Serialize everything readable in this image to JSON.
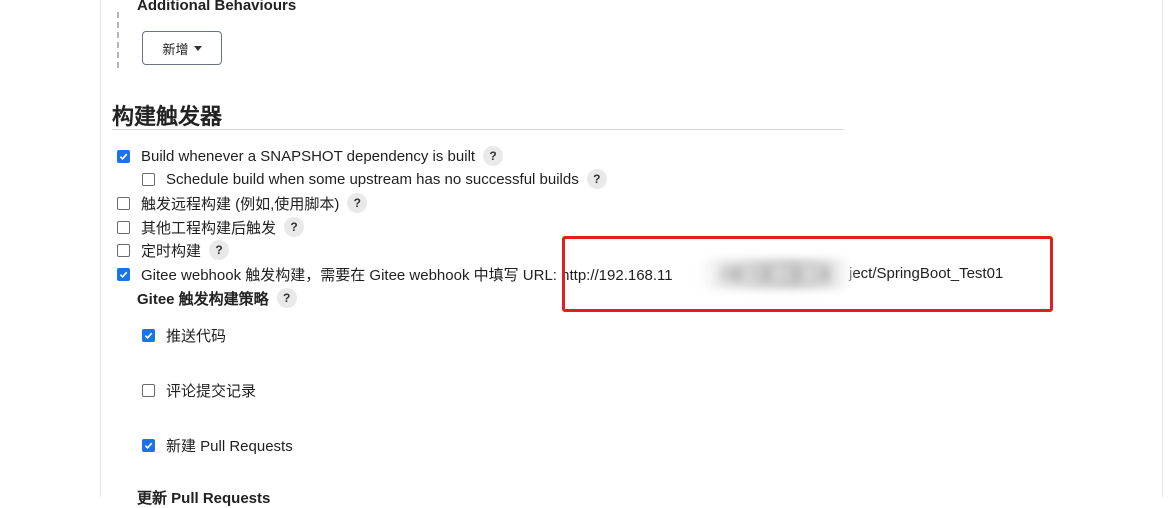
{
  "additional_behaviours": {
    "title": "Additional Behaviours",
    "add_button_label": "新增"
  },
  "build_triggers": {
    "heading": "构建触发器",
    "help_label": "?",
    "options": [
      {
        "label": "Build whenever a SNAPSHOT dependency is built",
        "checked": true
      },
      {
        "label": "Schedule build when some upstream has no successful builds",
        "checked": false
      },
      {
        "label": "触发远程构建 (例如,使用脚本)",
        "checked": false
      },
      {
        "label": "其他工程构建后触发",
        "checked": false
      },
      {
        "label": "定时构建",
        "checked": false
      },
      {
        "label_prefix": "Gitee webhook 触发构建，需要在 Gitee webhook 中填写 URL: http://192.168.11",
        "label_suffix": "ject/SpringBoot_Test01",
        "checked": true
      }
    ]
  },
  "gitee_strategy": {
    "title": "Gitee 触发构建策略",
    "options": [
      {
        "label": "推送代码",
        "checked": true
      },
      {
        "label": "评论提交记录",
        "checked": false
      },
      {
        "label": "新建 Pull Requests",
        "checked": true
      }
    ],
    "next_partial_label": "更新 Pull Requests"
  },
  "colors": {
    "checkbox_checked": "#1a73e8",
    "highlight": "#e02020"
  }
}
